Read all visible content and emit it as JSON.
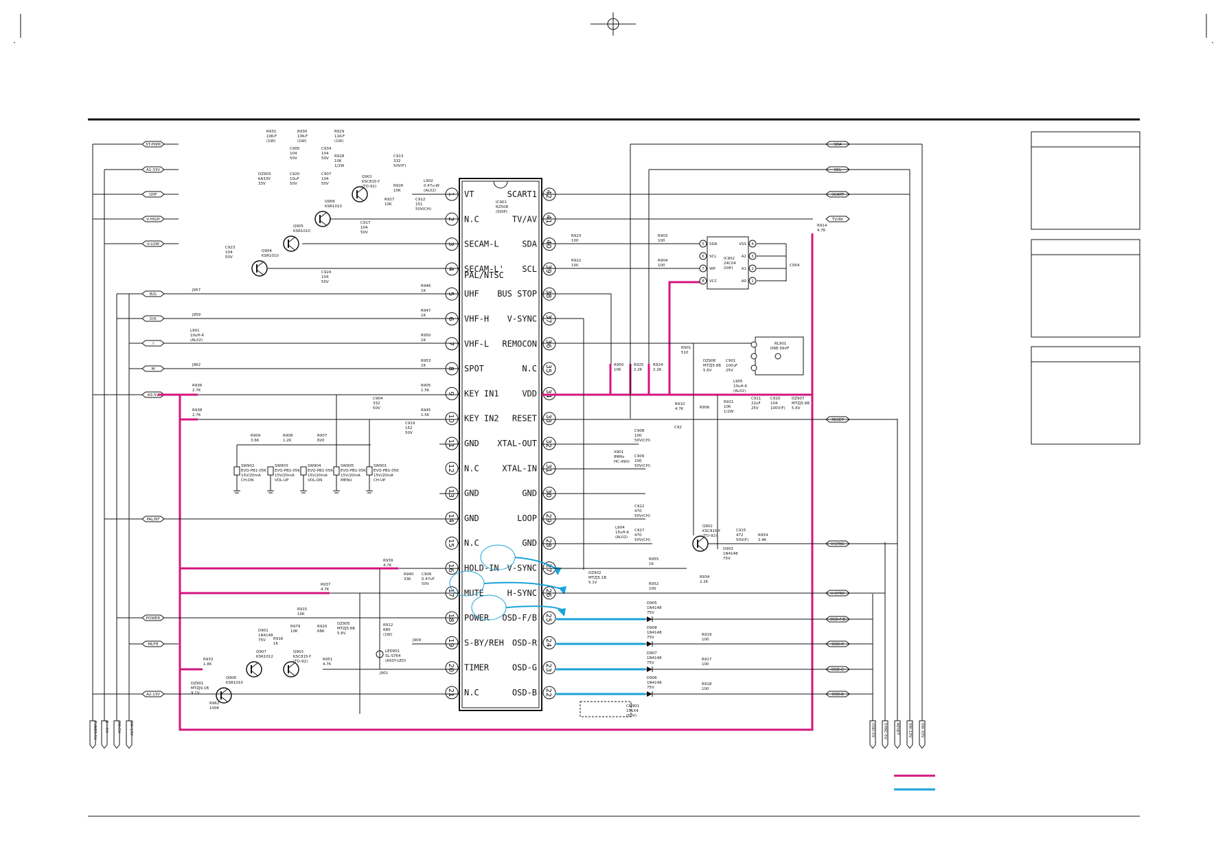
{
  "ic": {
    "ref": "IC901",
    "part": "RZ508",
    "pkg": "(SDIP)",
    "left_pins": [
      {
        "n": "1",
        "label": "VT"
      },
      {
        "n": "2",
        "label": "N.C"
      },
      {
        "n": "3",
        "label": "SECAM-L"
      },
      {
        "n": "4",
        "label": "SECAM-L'"
      },
      {
        "n": "5",
        "label": "UHF"
      },
      {
        "n": "6",
        "label": "VHF-H"
      },
      {
        "n": "7",
        "label": "VHF-L"
      },
      {
        "n": "8",
        "label": "SPOT"
      },
      {
        "n": "9",
        "label": "KEY IN1"
      },
      {
        "n": "10",
        "label": "KEY IN2"
      },
      {
        "n": "11",
        "label": "GND"
      },
      {
        "n": "12",
        "label": "N.C"
      },
      {
        "n": "13",
        "label": "GND"
      },
      {
        "n": "14",
        "label": "GND"
      },
      {
        "n": "15",
        "label": "N.C"
      },
      {
        "n": "16",
        "label": "HOLD-IN"
      },
      {
        "n": "17",
        "label": "MUTE"
      },
      {
        "n": "18",
        "label": "POWER"
      },
      {
        "n": "19",
        "label": "S-BY/REH"
      },
      {
        "n": "20",
        "label": "TIMER"
      },
      {
        "n": "21",
        "label": "N.C"
      }
    ],
    "pin4_sub": "PAL/NTSC",
    "right_pins": [
      {
        "n": "42",
        "label": "SCART1"
      },
      {
        "n": "41",
        "label": "TV/AV"
      },
      {
        "n": "40",
        "label": "SDA"
      },
      {
        "n": "39",
        "label": "SCL"
      },
      {
        "n": "38",
        "label": "BUS STOP"
      },
      {
        "n": "37",
        "label": "V-SYNC"
      },
      {
        "n": "36",
        "label": "REMOCON"
      },
      {
        "n": "35",
        "label": "N.C"
      },
      {
        "n": "34",
        "label": "VDD"
      },
      {
        "n": "33",
        "label": "RESET"
      },
      {
        "n": "32",
        "label": "XTAL-OUT"
      },
      {
        "n": "31",
        "label": "XTAL-IN"
      },
      {
        "n": "30",
        "label": "GND"
      },
      {
        "n": "29",
        "label": "LOOP"
      },
      {
        "n": "28",
        "label": "GND"
      },
      {
        "n": "27",
        "label": "V-SYNC"
      },
      {
        "n": "26",
        "label": "H-SYNC"
      },
      {
        "n": "25",
        "label": "OSD-F/B"
      },
      {
        "n": "24",
        "label": "OSD-R"
      },
      {
        "n": "23",
        "label": "OSD-G"
      },
      {
        "n": "22",
        "label": "OSD-B"
      }
    ]
  },
  "left_tags": [
    "ST-PWM",
    "A1-33V",
    "UHF",
    "V-HIGH",
    "V-LOW",
    "B/G",
    "D/K",
    "I",
    "M",
    "A3-5V",
    "PAL/NT",
    "POWER",
    "MUTE",
    "A2-13V"
  ],
  "right_tags": [
    "SDA",
    "SCL",
    "SCART",
    "TV/AV",
    "RESET",
    "V-SYNC",
    "H-SYNC",
    "OSD-F/B",
    "OSD-R",
    "OSD-G",
    "OSD-B"
  ],
  "bottom_left_tags": [
    "TUNER-5V",
    "B+-5V",
    "SW-5V",
    "SW-13V"
  ],
  "bottom_right_tags": [
    "OSD-5V",
    "SYNC-5V",
    "RESET",
    "SW-13V",
    "SW-33V"
  ],
  "eeprom": {
    "ref": "IC902",
    "part": "24C04",
    "pkg": "(DIP)",
    "left_pins": [
      {
        "n": "5",
        "label": "SDA"
      },
      {
        "n": "6",
        "label": "SCL"
      },
      {
        "n": "7",
        "label": "WP"
      },
      {
        "n": "8",
        "label": "VCC"
      }
    ],
    "right_pins": [
      {
        "n": "4",
        "label": "VSS"
      },
      {
        "n": "3",
        "label": "A2"
      },
      {
        "n": "2",
        "label": "A1"
      },
      {
        "n": "1",
        "label": "A0"
      }
    ]
  },
  "remote": {
    "ref": "RL901",
    "part": "DRE-56VF"
  },
  "switches": [
    {
      "ref": "SW902",
      "part": "EVQ-PB1-05K",
      "rating": "15V/20mA",
      "func": "CH-DN"
    },
    {
      "ref": "SW903",
      "part": "EVQ-PB1-05K",
      "rating": "15V/20mA",
      "func": "VOL-UP"
    },
    {
      "ref": "SW904",
      "part": "EVQ-PB1-05K",
      "rating": "15V/20mA",
      "func": "VOL-DN"
    },
    {
      "ref": "SW905",
      "part": "EVQ-PB1-05K",
      "rating": "15V/20mA",
      "func": "MENU"
    },
    {
      "ref": "SW901",
      "part": "EVQ-PB1-05K",
      "rating": "15V/20mA",
      "func": "CH-UP"
    }
  ],
  "transistors": [
    {
      "ref": "Q901",
      "part": "KSC815-Y",
      "pkg": "(TO-92)"
    },
    {
      "ref": "Q906",
      "part": "KSR1010"
    },
    {
      "ref": "Q905",
      "part": "KSR1010"
    },
    {
      "ref": "Q904",
      "part": "KSR1010"
    },
    {
      "ref": "Q902",
      "part": "KSC815-Y",
      "pkg": "(TO-92)"
    },
    {
      "ref": "Q907",
      "part": "KSR1012"
    },
    {
      "ref": "Q903",
      "part": "KSC815-Y",
      "pkg": "(TO-92)"
    },
    {
      "ref": "Q908",
      "part": "KSR1010"
    }
  ],
  "parts": {
    "r931": "R931",
    "r931v": "10K-F",
    "r931t": "(1W)",
    "r930": "R930",
    "r930v": "10K-F",
    "r930t": "(1W)",
    "r929": "R929",
    "r929v": "11K-F",
    "r929t": "(1W)",
    "c905": "C905",
    "c905v": "104",
    "c905r": "50V",
    "c934": "C934",
    "c934v": "104",
    "c934r": "50V",
    "r928": "R928",
    "r928v": "10K",
    "r928r": "1/2W",
    "dz903": "DZ903",
    "dz903v": "KA33V",
    "dz903r": "33V",
    "c920": "C920",
    "c920v": "10uF",
    "c920r": "50V",
    "c907": "C907",
    "c907v": "104",
    "c907r": "50V",
    "c913": "C913",
    "c913v": "332",
    "c913r": "50V(F)",
    "r926": "R926",
    "r926v": "10K",
    "l902": "L902",
    "l902v": "0.47u-W",
    "l902r": "(AL02)",
    "r927": "R927",
    "r927v": "10K",
    "c912": "C912",
    "c912v": "151",
    "c912r": "50V(CH)",
    "c917": "C917",
    "c917v": "104",
    "c917r": "50V",
    "c923": "C923",
    "c923v": "104",
    "c923r": "50V",
    "c924": "C924",
    "c924v": "104",
    "c924r": "50V",
    "r946": "R946",
    "r946v": "1K",
    "r947": "R947",
    "r947v": "1K",
    "r950": "R950",
    "r950v": "1K",
    "r953": "R953",
    "r953v": "1K",
    "r905": "R905",
    "r905v": "1.5K",
    "r945": "R945",
    "r945v": "1.5K",
    "j957": "J957",
    "j959": "J959",
    "j962": "J962",
    "l901": "L901",
    "l901v": "10uH-K",
    "l901r": "(AL02)",
    "r936": "R936",
    "r936v": "2.7K",
    "r938": "R938",
    "r938v": "2.7K",
    "c904": "C904",
    "c904v": "332",
    "c904r": "50V",
    "c919": "C919",
    "c919v": "152",
    "c919r": "50V",
    "r909": "R909",
    "r909v": "3.6K",
    "r908": "R908",
    "r908v": "1.2K",
    "r907": "R907",
    "r907v": "820",
    "r923": "R923",
    "r923v": "100",
    "r922": "R922",
    "r922v": "100",
    "r903": "R903",
    "r903v": "100",
    "r904": "R904",
    "r904v": "100",
    "r914": "R914",
    "r914v": "4.7K",
    "c954": "C954",
    "r901": "R901",
    "r901v": "510",
    "dz906": "DZ906",
    "dz906v": "MTZJ5.6B",
    "dz906r": "5.6V",
    "c901": "C901",
    "c901v": "100uF",
    "c901r": "25V",
    "l905": "L905",
    "l905v": "10uH-K",
    "l905r": "(AL02)",
    "r950b": "R950",
    "r950bv": "10K",
    "r925": "R925",
    "r925v": "2.2K",
    "r924": "R924",
    "r924v": "2.2K",
    "r910": "R910",
    "r910v": "4.7K",
    "r906": "R906",
    "r921": "R921",
    "r921v": "10K",
    "r921r": "1/2W",
    "c911": "C911",
    "c911v": "22uF",
    "c911r": "25V",
    "c910": "C910",
    "c910v": "104",
    "c910r": "100V(F)",
    "dz907": "DZ907",
    "dz907v": "MTZJ5.6B",
    "dz907r": "5.6V",
    "c92": "C92",
    "c908": "C908",
    "c908v": "100",
    "c908r": "50V(CH)",
    "x901": "X901",
    "x901v": "8MHz",
    "x901r": "HC-49/U",
    "c909": "C909",
    "c909v": "100",
    "c909r": "50V(CH)",
    "c922": "C922",
    "c922v": "470",
    "c922r": "50V(CH)",
    "l904": "L904",
    "l904v": "15uH-K",
    "l904r": "(AL02)",
    "c927": "C927",
    "c927v": "470",
    "c927r": "50V(CH)",
    "c915": "C915",
    "c915v": "472",
    "c915r": "50V(F)",
    "r954": "R954",
    "r954v": "2.4K",
    "d903": "D903",
    "d903v": "1N4148",
    "d903r": "75V",
    "r934": "R934",
    "r934v": "2.2K",
    "r955": "R955",
    "r955v": "1K",
    "r952": "R952",
    "r952v": "100",
    "dz902": "DZ902",
    "dz902v": "MTZJ5.1B",
    "dz902r": "5.1V",
    "d905": "D905",
    "d905v": "1N4148",
    "d905r": "75V",
    "d908": "D908",
    "d908v": "1N4148",
    "d908r": "75V",
    "d907": "D907",
    "d907v": "1N4148",
    "d907r": "75V",
    "d906": "D906",
    "d906v": "1N4148",
    "d906r": "75V",
    "r919": "R919",
    "r919v": "100",
    "r917": "R917",
    "r917v": "100",
    "r918": "R918",
    "r918v": "100",
    "cm901": "CM901",
    "cm901v": "151X4",
    "cm901r": "(50V)",
    "r939": "R939",
    "r939v": "4.7K",
    "r940": "R940",
    "r940v": "33K",
    "c906": "C906",
    "c906v": "0.47uF",
    "c906r": "50V",
    "r937": "R937",
    "r937v": "4.7K",
    "r915": "R915",
    "r915v": "10K",
    "r979": "R979",
    "r979v": "10K",
    "r920": "R920",
    "r920v": "68K",
    "dz905": "DZ905",
    "dz905v": "MTZJ5.6B",
    "dz905r": "5.6V",
    "r912": "R912",
    "r912v": "680",
    "r912r": "(1W)",
    "j909": "J909",
    "r916": "R916",
    "r916v": "1K",
    "d901": "D901",
    "d901v": "1N4148",
    "d901r": "75V",
    "r933": "R933",
    "r933v": "1.8K",
    "r951": "R951",
    "r951v": "4.7K",
    "led": "LED901",
    "ledv": "SL-S764",
    "ledr": "(ASSY-LED)",
    "j901": "J901",
    "dz901": "DZ901",
    "dz901v": "MTZJ9.1B",
    "dz901r": "9.1V",
    "r962": "R962",
    "r962v": "100K"
  },
  "colors": {
    "power_net": "#d4147f",
    "osd_net": "#1aa2d9",
    "ink": "#111111"
  }
}
